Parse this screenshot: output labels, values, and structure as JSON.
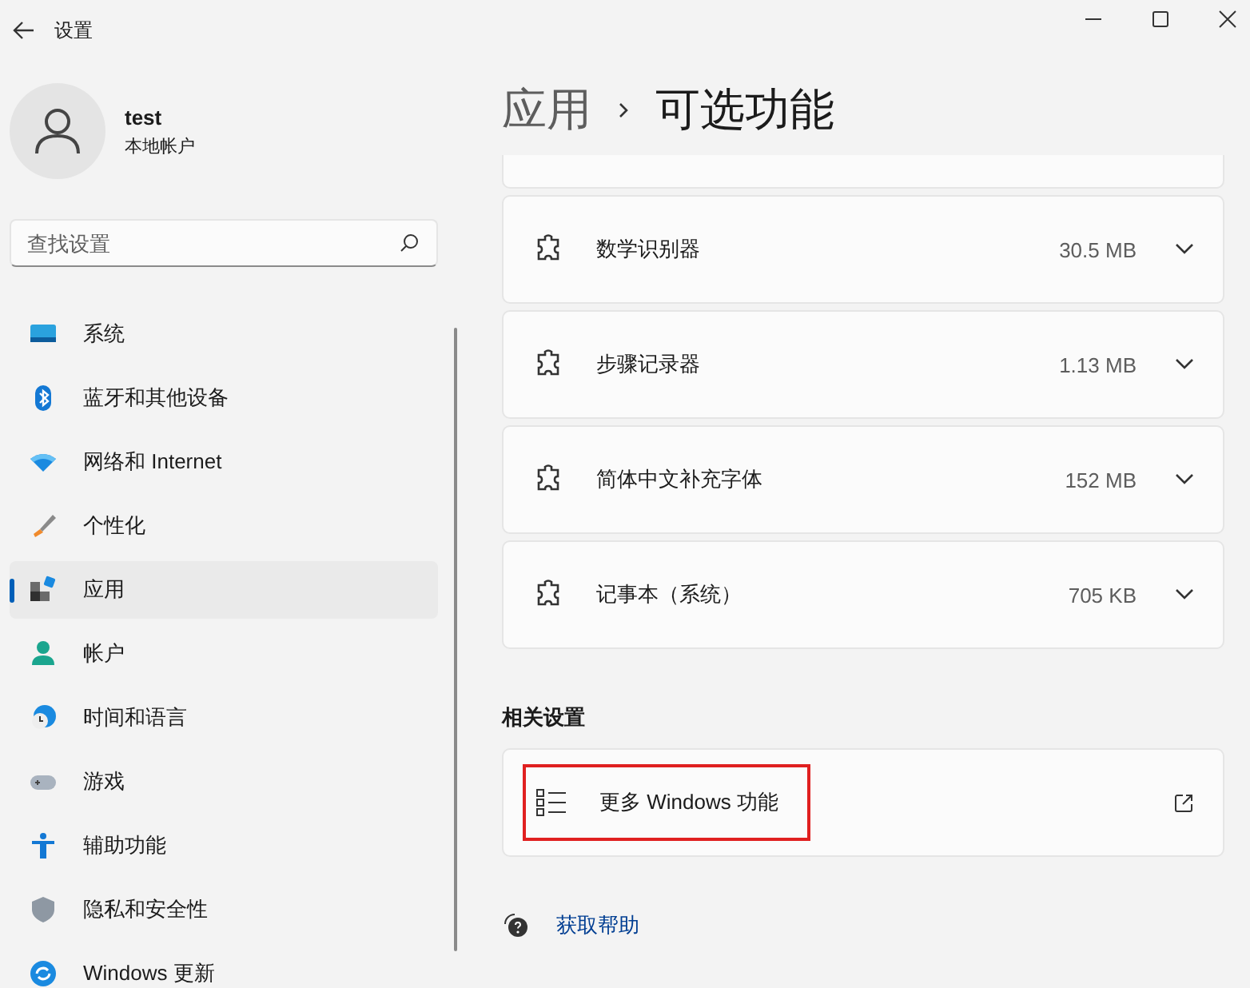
{
  "window": {
    "title": "设置"
  },
  "profile": {
    "name": "test",
    "account_type": "本地帐户"
  },
  "search": {
    "placeholder": "查找设置"
  },
  "nav": [
    {
      "label": "系统",
      "selected": false
    },
    {
      "label": "蓝牙和其他设备",
      "selected": false
    },
    {
      "label": "网络和 Internet",
      "selected": false
    },
    {
      "label": "个性化",
      "selected": false
    },
    {
      "label": "应用",
      "selected": true
    },
    {
      "label": "帐户",
      "selected": false
    },
    {
      "label": "时间和语言",
      "selected": false
    },
    {
      "label": "游戏",
      "selected": false
    },
    {
      "label": "辅助功能",
      "selected": false
    },
    {
      "label": "隐私和安全性",
      "selected": false
    },
    {
      "label": "Windows 更新",
      "selected": false
    }
  ],
  "breadcrumb": {
    "parent": "应用",
    "current": "可选功能"
  },
  "features": [
    {
      "name": "数学识别器",
      "size": "30.5 MB",
      "expanded": false
    },
    {
      "name": "步骤记录器",
      "size": "1.13 MB",
      "expanded": false
    },
    {
      "name": "简体中文补充字体",
      "size": "152 MB",
      "expanded": false
    },
    {
      "name": "记事本（系统）",
      "size": "705 KB",
      "expanded": false
    }
  ],
  "related": {
    "heading": "相关设置",
    "items": [
      {
        "label": "更多 Windows 功能",
        "highlighted": true
      }
    ]
  },
  "help": {
    "label": "获取帮助"
  }
}
